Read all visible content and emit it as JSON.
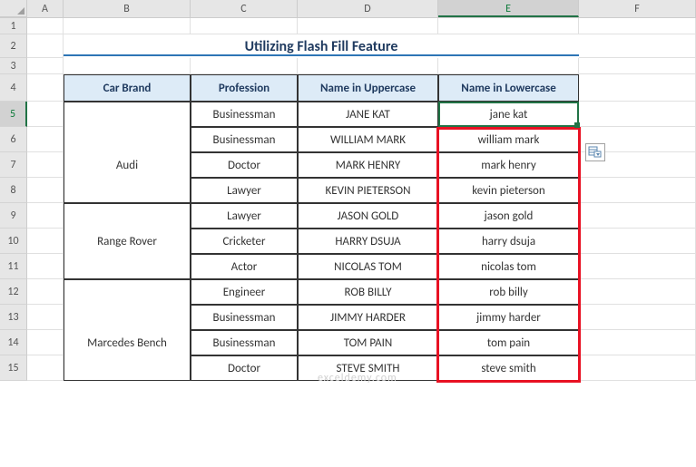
{
  "columns": [
    "A",
    "B",
    "C",
    "D",
    "E",
    "F"
  ],
  "rows": [
    "1",
    "2",
    "3",
    "4",
    "5",
    "6",
    "7",
    "8",
    "9",
    "10",
    "11",
    "12",
    "13",
    "14",
    "15"
  ],
  "selected_col": "E",
  "selected_row": "5",
  "title": "Utilizing Flash Fill Feature",
  "headers": {
    "b": "Car Brand",
    "c": "Profession",
    "d": "Name in Uppercase",
    "e": "Name in Lowercase"
  },
  "watermark": "exceldemy.com",
  "chart_data": {
    "type": "table",
    "title": "Utilizing Flash Fill Feature",
    "columns": [
      "Car Brand",
      "Profession",
      "Name in Uppercase",
      "Name in Lowercase"
    ],
    "rows": [
      {
        "brand": "Audi",
        "profession": "Businessman",
        "upper": "JANE KAT",
        "lower": "jane kat"
      },
      {
        "brand": "Audi",
        "profession": "Businessman",
        "upper": "WILLIAM MARK",
        "lower": "william mark"
      },
      {
        "brand": "Audi",
        "profession": "Doctor",
        "upper": "MARK HENRY",
        "lower": "mark henry"
      },
      {
        "brand": "Audi",
        "profession": "Lawyer",
        "upper": "KEVIN PIETERSON",
        "lower": "kevin pieterson"
      },
      {
        "brand": "Range Rover",
        "profession": "Lawyer",
        "upper": "JASON GOLD",
        "lower": "jason gold"
      },
      {
        "brand": "Range Rover",
        "profession": "Cricketer",
        "upper": "HARRY DSUJA",
        "lower": "harry dsuja"
      },
      {
        "brand": "Range Rover",
        "profession": "Actor",
        "upper": "NICOLAS TOM",
        "lower": "nicolas tom"
      },
      {
        "brand": "Marcedes Bench",
        "profession": "Engineer",
        "upper": "ROB BILLY",
        "lower": "rob billy"
      },
      {
        "brand": "Marcedes Bench",
        "profession": "Businessman",
        "upper": "JIMMY HARDER",
        "lower": "jimmy harder"
      },
      {
        "brand": "Marcedes Bench",
        "profession": "Businessman",
        "upper": "TOM PAIN",
        "lower": "tom pain"
      },
      {
        "brand": "Marcedes Bench",
        "profession": "Doctor",
        "upper": "STEVE SMITH",
        "lower": "steve smith"
      }
    ],
    "merged_brands": [
      {
        "label": "Audi",
        "rowspan": 4
      },
      {
        "label": "Range Rover",
        "rowspan": 3
      },
      {
        "label": "Marcedes Bench",
        "rowspan": 4
      }
    ]
  }
}
